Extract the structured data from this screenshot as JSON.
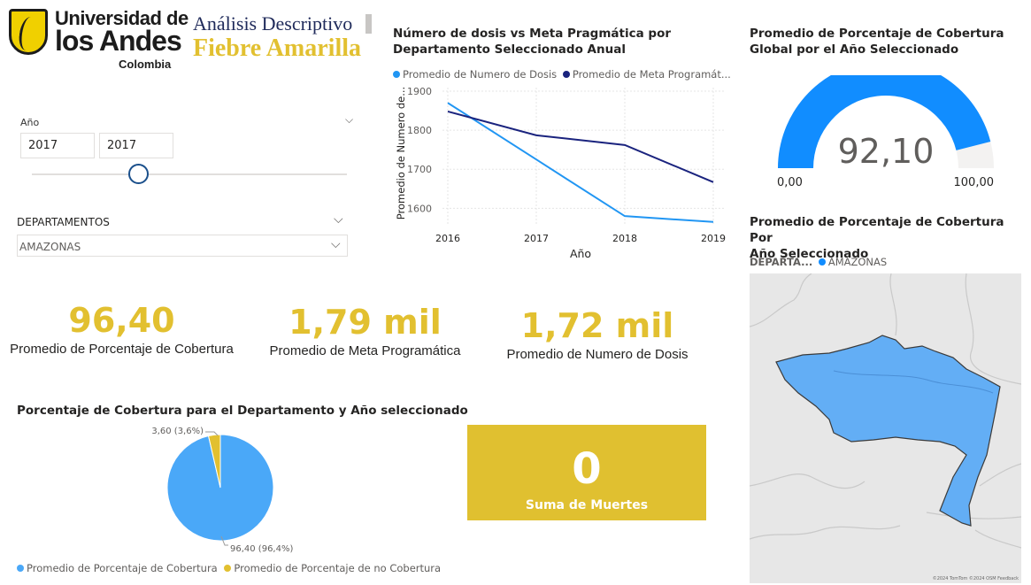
{
  "logo": {
    "line1": "Universidad de",
    "line2": "los Andes",
    "line3": "Colombia"
  },
  "header": {
    "title": "Análisis Descriptivo",
    "subtitle": "Fiebre Amarilla"
  },
  "slicer_year": {
    "label": "Año",
    "from": "2017",
    "to": "2017"
  },
  "slicer_dept": {
    "label": "DEPARTAMENTOS",
    "selected": "AMAZONAS"
  },
  "line_chart": {
    "title_line1": "Número de dosis vs Meta Pragmática por",
    "title_line2": "Departamento Seleccionado Anual",
    "legend": [
      "Promedio de Numero de Dosis",
      "Promedio de Meta Programát..."
    ],
    "ylabel": "Promedio de Numero de...",
    "xlabel": "Año"
  },
  "gauge": {
    "title_line1": "Promedio de Porcentaje de Cobertura",
    "title_line2": "Global por el Año Seleccionado",
    "value_label": "92,10",
    "min_label": "0,00",
    "max_label": "100,00",
    "value": 92.1,
    "min": 0,
    "max": 100,
    "color_fill": "#118dff",
    "color_track": "#f3f2f1"
  },
  "kpis": [
    {
      "value": "96,40",
      "label": "Promedio de Porcentaje de Cobertura"
    },
    {
      "value": "1,79 mil",
      "label": "Promedio de Meta Programática"
    },
    {
      "value": "1,72 mil",
      "label": "Promedio de Numero de Dosis"
    }
  ],
  "pie_chart": {
    "title": "Porcentaje de Cobertura para el Departamento y Año seleccionado",
    "legend": [
      "Promedio de Porcentaje de Cobertura",
      "Promedio de Porcentaje de no Cobertura"
    ],
    "label_small": "3,60 (3,6%)",
    "label_large": "96,40 (96,4%)"
  },
  "deaths_card": {
    "value": "0",
    "label": "Suma de Muertes"
  },
  "map": {
    "title_line1": "Promedio de Porcentaje de Cobertura Por",
    "title_line2": "Año Seleccionado",
    "legend_field": "DEPARTA...",
    "legend_item": "AMAZONAS",
    "attribution": "©2024 TomTom ©2024 OSM Feedback",
    "region_color": "#63aef5"
  },
  "colors": {
    "accent_yellow": "#e2c030",
    "series_light_blue": "#2196f3",
    "series_navy": "#1a237e",
    "pie_blue": "#4aa8f8",
    "pie_yellow": "#e2c030"
  },
  "chart_data": [
    {
      "type": "line",
      "x": [
        2016,
        2017,
        2018,
        2019
      ],
      "series": [
        {
          "name": "Promedio de Numero de Dosis",
          "values": [
            1870,
            1725,
            1580,
            1565
          ]
        },
        {
          "name": "Promedio de Meta Programát...",
          "values": [
            1848,
            1787,
            1762,
            1667
          ]
        }
      ],
      "yticks": [
        1600,
        1700,
        1800,
        1900
      ],
      "xticks": [
        "2016",
        "2017",
        "2018",
        "2019"
      ],
      "ylim": [
        1560,
        1900
      ],
      "xlabel": "Año",
      "ylabel": "Promedio de Numero de...",
      "grid": true,
      "legend": "top-left"
    },
    {
      "type": "pie",
      "labels": [
        "Promedio de Porcentaje de Cobertura",
        "Promedio de Porcentaje de no Cobertura"
      ],
      "values": [
        96.4,
        3.6
      ],
      "legend": "bottom"
    }
  ]
}
